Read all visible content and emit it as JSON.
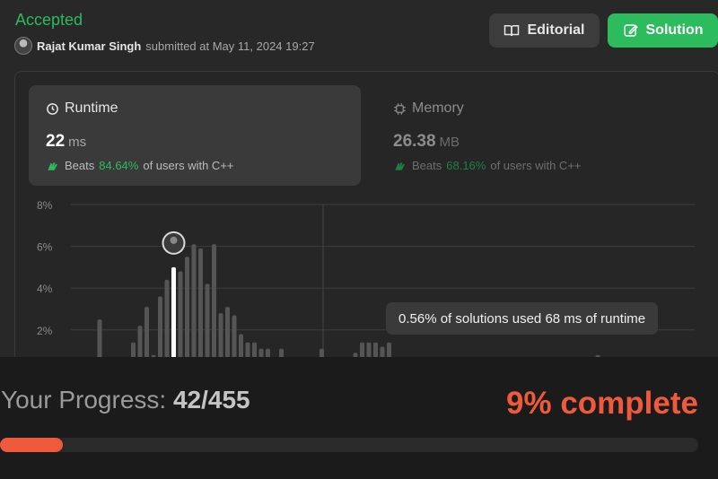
{
  "submission": {
    "status": "Accepted",
    "user": "Rajat Kumar Singh",
    "submitted_text": "submitted at May 11, 2024 19:27"
  },
  "buttons": {
    "editorial": "Editorial",
    "solution": "Solution"
  },
  "runtime": {
    "label": "Runtime",
    "value": "22",
    "unit": "ms",
    "beats_label": "Beats",
    "beats_pct": "84.64%",
    "beats_suffix": "of users with C++"
  },
  "memory": {
    "label": "Memory",
    "value": "26.38",
    "unit": "MB",
    "beats_label": "Beats",
    "beats_pct": "68.16%",
    "beats_suffix": "of users with C++"
  },
  "tooltip": "0.56% of solutions used 68 ms of runtime",
  "progress": {
    "label": "Your Progress:",
    "count": "42/455",
    "complete": "9% complete",
    "fraction": 0.09
  },
  "colors": {
    "accent_green": "#2cbb5d",
    "progress_orange": "#ef5a3d",
    "bar_gray": "#555555",
    "highlight_bar": "#ffffff"
  },
  "chart_data": {
    "type": "bar",
    "yticks": [
      "8%",
      "6%",
      "4%",
      "2%"
    ],
    "ylim": [
      0,
      8
    ],
    "x_ms": [
      0,
      2,
      4,
      6,
      8,
      10,
      12,
      14,
      16,
      18,
      20,
      22,
      24,
      26,
      28,
      30,
      32,
      34,
      36,
      38,
      40,
      42,
      44,
      46,
      48,
      50,
      52,
      54,
      56,
      58,
      60,
      62,
      64,
      66,
      68,
      70,
      72,
      74,
      76,
      78,
      80,
      82,
      84,
      86,
      88,
      90,
      92,
      94,
      96,
      98,
      100,
      102,
      104,
      106,
      108,
      110,
      112,
      114,
      116,
      118,
      120,
      122,
      124,
      126,
      128,
      130,
      132,
      134,
      136,
      138,
      140,
      142,
      144,
      146,
      148,
      150
    ],
    "values": [
      2.5,
      0,
      0,
      0,
      0,
      1.4,
      2.2,
      3.1,
      0.8,
      3.6,
      4.4,
      5.0,
      4.8,
      5.5,
      6.1,
      5.9,
      4.2,
      6.1,
      2.8,
      3.1,
      2.7,
      1.8,
      1.4,
      1.4,
      1.1,
      1.1,
      0,
      1.1,
      0,
      0,
      0,
      0,
      0,
      1.1,
      0,
      0,
      0,
      0,
      0.9,
      1.4,
      1.4,
      1.4,
      1.2,
      1.4,
      0,
      0,
      0,
      0,
      0,
      0,
      0,
      0,
      0,
      0,
      0,
      0,
      0,
      0,
      0,
      0,
      0,
      0,
      0,
      0,
      0,
      0,
      0,
      0,
      0,
      0,
      0,
      0,
      0,
      0,
      0.8,
      0
    ],
    "highlight_ms": 22,
    "marker_ms": 68
  }
}
